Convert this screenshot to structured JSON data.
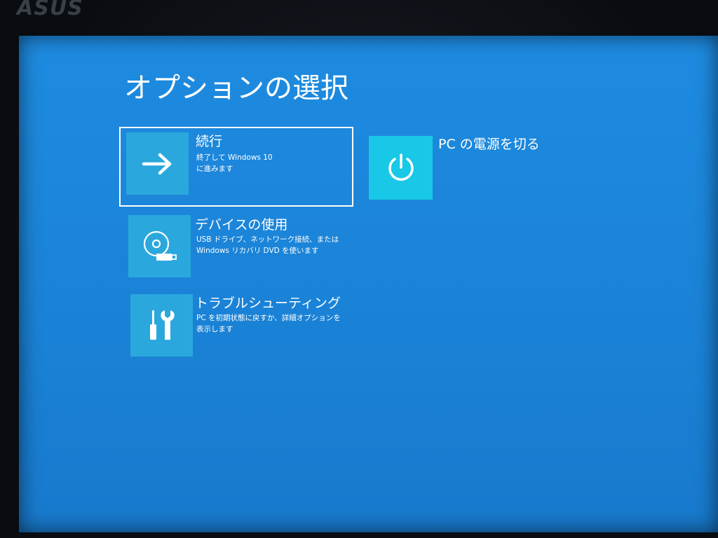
{
  "device": {
    "brand_logo": "ASUS"
  },
  "screen": {
    "title": "オプションの選択"
  },
  "options": [
    {
      "id": "continue",
      "title": "続行",
      "description": "終了して Windows 10\nに進みます",
      "icon": "arrow-right-icon",
      "selected": true
    },
    {
      "id": "use-device",
      "title": "デバイスの使用",
      "description": "USB ドライブ、ネットワーク接続、または\nWindows リカバリ DVD を使います",
      "icon": "disc-usb-icon",
      "selected": false
    },
    {
      "id": "troubleshoot",
      "title": "トラブルシューティング",
      "description": "PC を初期状態に戻すか、詳細オプションを\n表示します",
      "icon": "tools-icon",
      "selected": false
    },
    {
      "id": "power-off",
      "title": "PC の電源を切る",
      "icon": "power-icon",
      "selected": false
    }
  ],
  "colors": {
    "background": "#1a82d6",
    "tile": "#2aa8dd",
    "power_tile": "#18c8e6",
    "text": "#ffffff"
  }
}
